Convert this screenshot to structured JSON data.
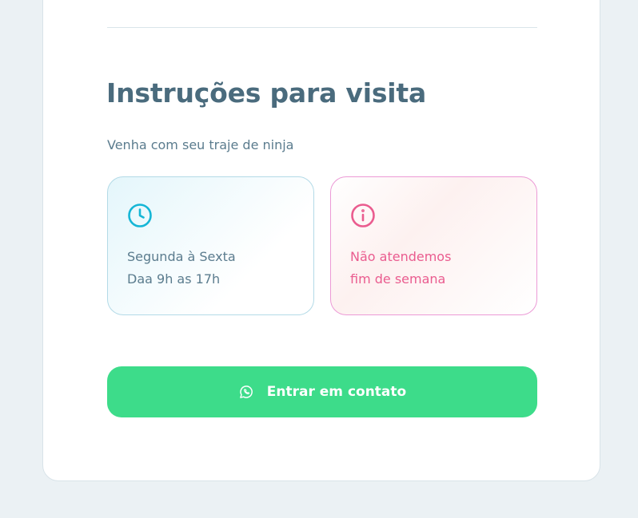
{
  "section": {
    "title": "Instruções para visita",
    "subtitle": "Venha com seu traje de ninja"
  },
  "info_boxes": [
    {
      "icon": "clock-icon",
      "lines": [
        "Segunda à Sexta",
        "Daa 9h as 17h"
      ],
      "color": "#15B6D6"
    },
    {
      "icon": "info-icon",
      "lines": [
        "Não atendemos",
        "fim de semana"
      ],
      "color": "#EA5C8F"
    }
  ],
  "cta": {
    "icon": "whatsapp-icon",
    "label": "Entrar em contato",
    "color": "#3DDC8A"
  },
  "colors": {
    "background": "#EBF1F4",
    "card": "#FFFFFF",
    "title": "#4A6B7D",
    "text": "#5B7C8E"
  }
}
